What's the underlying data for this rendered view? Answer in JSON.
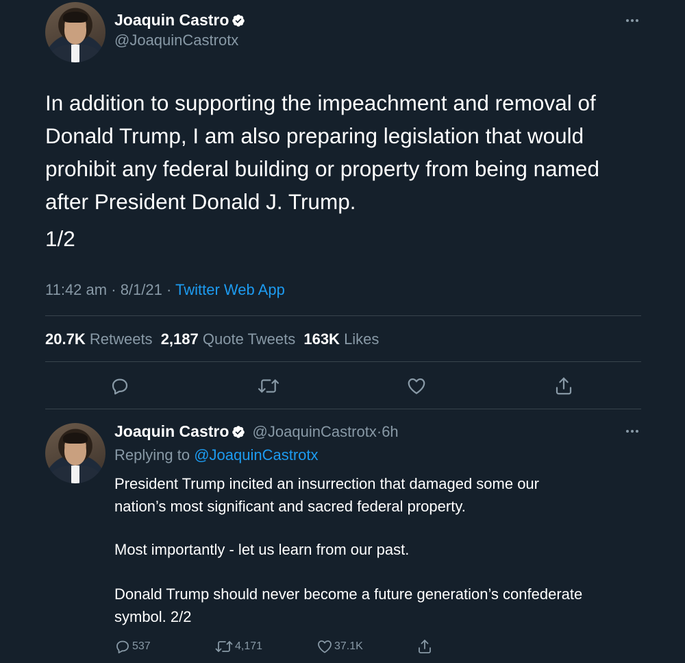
{
  "main_tweet": {
    "author_name": "Joaquin Castro",
    "handle": "@JoaquinCastrotx",
    "text_lines": [
      "In addition to supporting the impeachment and removal of",
      "Donald Trump, I am also preparing legislation that would",
      "prohibit any federal building or property from being named",
      "after President Donald J. Trump."
    ],
    "thread_count": "1/2",
    "time": "11:42 am",
    "date": "8/1/21",
    "source": "Twitter Web App",
    "sep": "·",
    "stats": {
      "retweets_count": "20.7K",
      "retweets_label": "Retweets",
      "quotes_count": "2,187",
      "quotes_label": "Quote Tweets",
      "likes_count": "163K",
      "likes_label": "Likes"
    }
  },
  "reply_tweet": {
    "author_name": "Joaquin Castro",
    "handle": "@JoaquinCastrotx",
    "age": "6h",
    "sep": "·",
    "replying_label": "Replying to",
    "replying_handle": "@JoaquinCastrotx",
    "para1_line1": "President Trump incited an insurrection that damaged some our",
    "para1_line2": "nation’s most significant and sacred federal property.",
    "para2": "Most importantly - let us learn from our past.",
    "para3_line1": "Donald Trump should never become a future generation’s confederate",
    "para3_line2": "symbol. 2/2",
    "actions": {
      "replies": "537",
      "retweets": "4,171",
      "likes": "37.1K"
    }
  },
  "icons": {
    "more": "more-horizontal-icon",
    "reply": "reply-icon",
    "retweet": "retweet-icon",
    "like": "heart-icon",
    "share": "share-icon",
    "verified": "verified-badge-icon"
  },
  "colors": {
    "background": "#15202b",
    "text": "#ffffff",
    "muted": "#8899a6",
    "link": "#1d9bf0",
    "divider": "#38444d"
  }
}
